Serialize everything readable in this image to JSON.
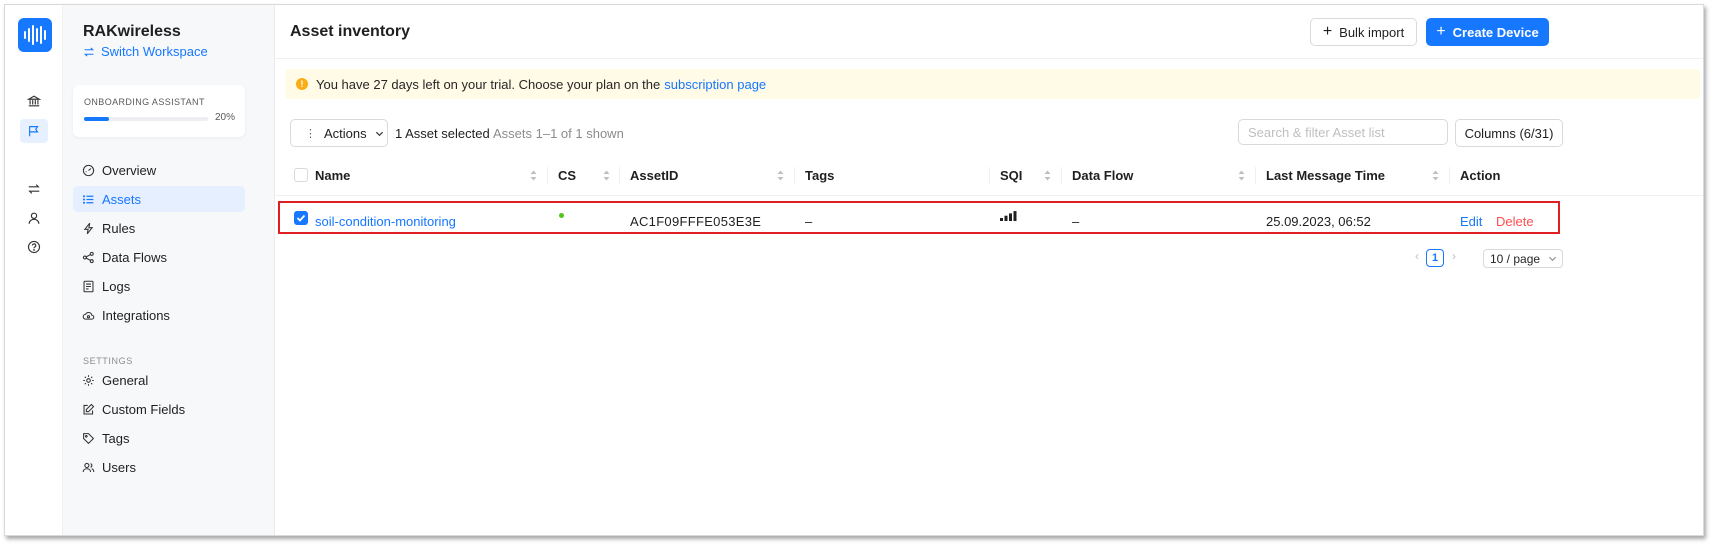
{
  "workspace": {
    "name": "RAKwireless",
    "switch_label": "Switch Workspace"
  },
  "onboarding": {
    "title": "ONBOARDING ASSISTANT",
    "percent_label": "20%",
    "progress": 0.2
  },
  "sidebar": {
    "items": [
      {
        "label": "Overview",
        "icon": "dashboard-icon"
      },
      {
        "label": "Assets",
        "icon": "list-icon",
        "active": true
      },
      {
        "label": "Rules",
        "icon": "lightning-icon"
      },
      {
        "label": "Data Flows",
        "icon": "share-icon"
      },
      {
        "label": "Logs",
        "icon": "document-icon"
      },
      {
        "label": "Integrations",
        "icon": "cloud-sync-icon"
      }
    ],
    "settings_title": "SETTINGS",
    "settings_items": [
      {
        "label": "General",
        "icon": "gear-icon"
      },
      {
        "label": "Custom Fields",
        "icon": "edit-icon"
      },
      {
        "label": "Tags",
        "icon": "tag-icon"
      },
      {
        "label": "Users",
        "icon": "users-icon"
      }
    ]
  },
  "header": {
    "title": "Asset inventory",
    "bulk_import_label": "Bulk import",
    "create_device_label": "Create Device"
  },
  "banner": {
    "text": "You have 27 days left on your trial. Choose your plan on the",
    "link_text": "subscription page"
  },
  "toolbar": {
    "actions_label": "Actions",
    "selected_text": "1 Asset selected",
    "shown_text": "Assets 1–1 of 1 shown",
    "search_placeholder": "Search & filter Asset list",
    "columns_label": "Columns (6/31)"
  },
  "table": {
    "columns": [
      "Name",
      "CS",
      "AssetID",
      "Tags",
      "SQI",
      "Data Flow",
      "Last Message Time",
      "Action"
    ],
    "rows": [
      {
        "name": "soil-condition-monitoring",
        "cs_status": "online",
        "asset_id": "AC1F09FFFE053E3E",
        "tags": "–",
        "sqi_level": 4,
        "data_flow": "–",
        "last_message_time": "25.09.2023, 06:52",
        "edit_label": "Edit",
        "delete_label": "Delete",
        "selected": true
      }
    ]
  },
  "pagination": {
    "current_page": "1",
    "page_size": "10 / page"
  },
  "colors": {
    "primary": "#1677ff",
    "danger": "#ff4d4f",
    "success": "#52c41a",
    "warning": "#faad14",
    "highlight": "#e02020"
  }
}
